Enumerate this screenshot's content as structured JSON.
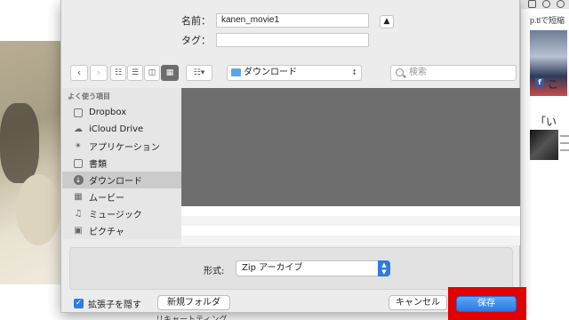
{
  "dialog": {
    "name_label": "名前：",
    "name_value": "kanen_movie1",
    "tag_label": "タグ：",
    "tag_value": "",
    "location_popup": "ダウンロード",
    "search_placeholder": "検索",
    "sidebar": {
      "heading": "よく使う項目",
      "items": [
        {
          "label": "Dropbox",
          "icon": "dropbox-icon"
        },
        {
          "label": "iCloud Drive",
          "icon": "cloud-icon"
        },
        {
          "label": "アプリケーション",
          "icon": "applications-icon"
        },
        {
          "label": "書類",
          "icon": "documents-icon"
        },
        {
          "label": "ダウンロード",
          "icon": "downloads-icon",
          "selected": true
        },
        {
          "label": "ムービー",
          "icon": "movie-icon"
        },
        {
          "label": "ミュージック",
          "icon": "music-icon"
        },
        {
          "label": "ピクチャ",
          "icon": "pictures-icon"
        }
      ]
    },
    "format_label": "形式:",
    "format_value": "Zip アーカイブ",
    "hide_extension_label": "拡張子を隠す",
    "new_folder_label": "新規フォルダ",
    "cancel_label": "キャンセル",
    "save_label": "保存"
  },
  "background": {
    "right_url_text": "p.tlで短縮",
    "right_cjk_1": "こ",
    "right_cjk_2": "「い",
    "below_dialog_text": "リキャートティング"
  },
  "colors": {
    "accent": "#2f7be0",
    "highlight": "#e00000",
    "sidebar_bg": "#e6e6e6",
    "preview_bg": "#6e6e6e"
  }
}
